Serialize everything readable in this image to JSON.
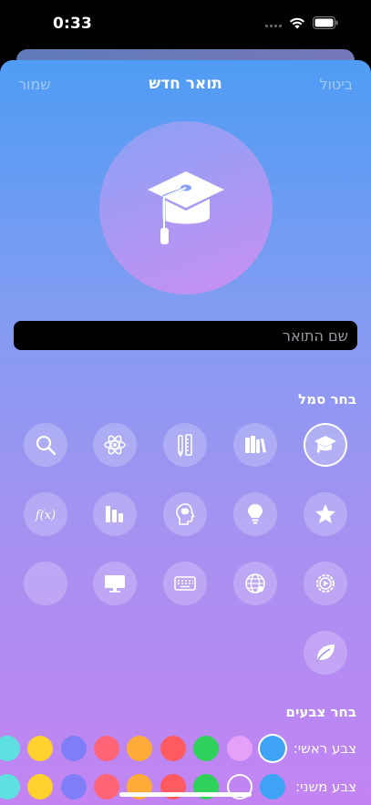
{
  "status_bar": {
    "time": "0:33"
  },
  "nav": {
    "cancel_label": "ביטול",
    "title": "תואר חדש",
    "save_label": "שמור"
  },
  "hero": {
    "icon": "graduation-cap-icon"
  },
  "name_field": {
    "placeholder": "שם התואר",
    "value": ""
  },
  "symbols": {
    "title": "בחר סמל",
    "icons": [
      {
        "name": "graduation-cap-icon",
        "selected": true
      },
      {
        "name": "books-icon",
        "selected": false
      },
      {
        "name": "pencil-ruler-icon",
        "selected": false
      },
      {
        "name": "atom-icon",
        "selected": false
      },
      {
        "name": "magnifying-glass-icon",
        "selected": false
      },
      {
        "name": "star-icon",
        "selected": false
      },
      {
        "name": "lightbulb-icon",
        "selected": false
      },
      {
        "name": "brain-head-icon",
        "selected": false
      },
      {
        "name": "bar-chart-icon",
        "selected": false
      },
      {
        "name": "function-icon",
        "selected": false
      },
      {
        "name": "gear-play-icon",
        "selected": false
      },
      {
        "name": "globe-network-icon",
        "selected": false
      },
      {
        "name": "keyboard-icon",
        "selected": false
      },
      {
        "name": "desktop-computer-icon",
        "selected": false
      },
      {
        "name": "empty-icon",
        "selected": false
      },
      {
        "name": "leaf-icon",
        "selected": false
      }
    ]
  },
  "colors": {
    "title": "בחר צבעים",
    "primary": {
      "label": "צבע ראשי:",
      "swatches": [
        "#3fa3f5",
        "#e5a0f8",
        "#2fd15a",
        "#ff5a5f",
        "#ffab3a",
        "#ff6477",
        "#7f7ef7",
        "#ffd02e",
        "#5fe0e0"
      ],
      "selected": 0
    },
    "secondary": {
      "label": "צבע משני:",
      "swatches": [
        "#3fa3f5",
        "transparent",
        "#2fd15a",
        "#ff5a5f",
        "#ffab3a",
        "#ff6477",
        "#7f7ef7",
        "#ffd02e",
        "#5fe0e0"
      ],
      "selected": 1
    }
  }
}
